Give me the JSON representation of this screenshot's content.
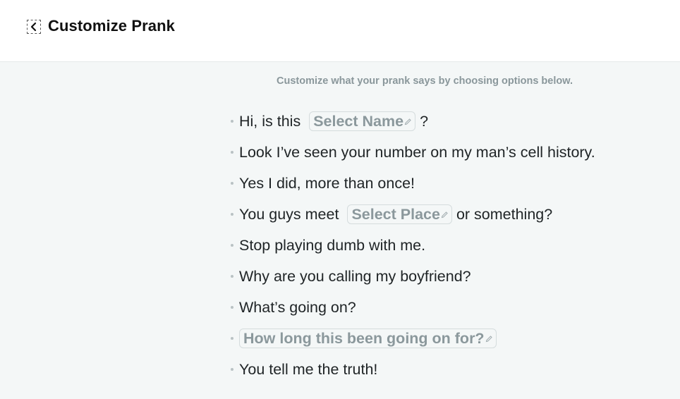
{
  "header": {
    "title": "Customize Prank",
    "back_icon": "chevron-left-icon"
  },
  "instructions": "Customize what your prank says by choosing options below.",
  "lines": [
    {
      "before": "Hi, is this",
      "chip": "Select Name",
      "after": "?"
    },
    {
      "before": "Look I’ve seen your number on my man’s cell history."
    },
    {
      "before": "Yes I did, more than once!"
    },
    {
      "before": "You guys meet",
      "chip": "Select Place",
      "after": "or something?"
    },
    {
      "before": "Stop playing dumb with me."
    },
    {
      "before": "Why are you calling my boyfriend?"
    },
    {
      "before": "What’s going on?"
    },
    {
      "chip": "How long this been going on for?"
    },
    {
      "before": "You tell me the truth!"
    }
  ],
  "colors": {
    "background": "#f4f7f7",
    "header_bg": "#ffffff",
    "chip_text": "#8b989c",
    "body_text": "#1f2426"
  }
}
